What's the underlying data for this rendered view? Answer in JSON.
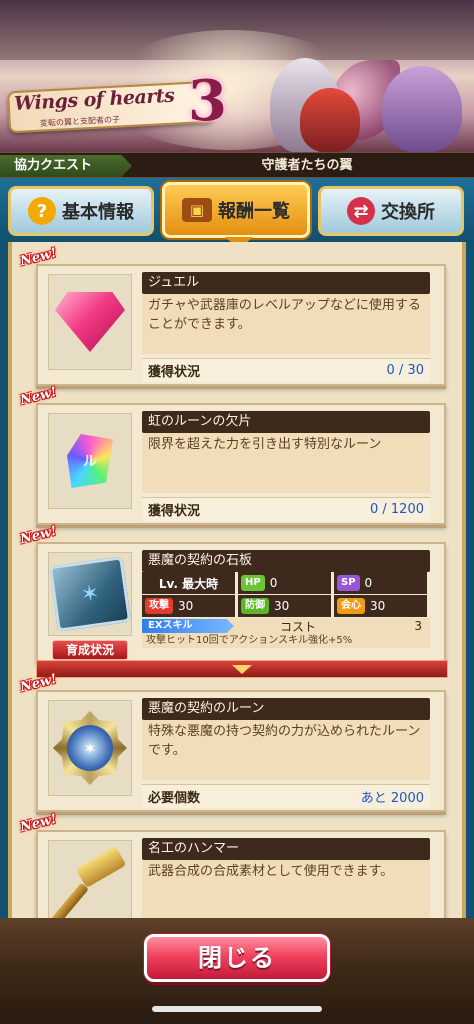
{
  "banner": {
    "logo_title": "Wings of hearts",
    "logo_number": "3",
    "logo_subtitle": "変転の翼と支配者の子"
  },
  "quest": {
    "label": "協力クエスト",
    "name": "守護者たちの翼"
  },
  "tabs": [
    {
      "label": "基本情報",
      "icon": "question-icon",
      "icon_glyph": "?"
    },
    {
      "label": "報酬一覧",
      "icon": "treasure-chest-icon",
      "icon_glyph": "▣"
    },
    {
      "label": "交換所",
      "icon": "exchange-bag-icon",
      "icon_glyph": "⇄"
    }
  ],
  "new_badge": "New!",
  "items": [
    {
      "title": "ジュエル",
      "description": "ガチャや武器庫のレベルアップなどに使用することができます。",
      "status_label": "獲得状況",
      "status_value": "0 / 30",
      "icon": "jewel-icon"
    },
    {
      "title": "虹のルーンの欠片",
      "description": "限界を超えた力を引き出す特別なルーン",
      "status_label": "獲得状況",
      "status_value": "0 / 1200",
      "icon": "rainbow-rune-icon"
    },
    {
      "title": "悪魔の契約の石板",
      "icon": "stone-tablet-icon",
      "level_label": "Lv. 最大時",
      "hp_label": "HP",
      "hp_value": "0",
      "sp_label": "SP",
      "sp_value": "0",
      "atk_label": "攻撃",
      "atk_value": "30",
      "def_label": "防御",
      "def_value": "30",
      "crit_label": "会心",
      "crit_value": "30",
      "ex_label": "EXスキル",
      "cost_label": "コスト",
      "cost_value": "3",
      "ex_description": "攻撃ヒット10回でアクションスキル強化+5%",
      "growth_button": "育成状況"
    },
    {
      "title": "悪魔の契約のルーン",
      "description": "特殊な悪魔の持つ契約の力が込められたルーンです。",
      "status_label": "必要個数",
      "status_value": "あと 2000",
      "icon": "demon-rune-medal-icon"
    },
    {
      "title": "名工のハンマー",
      "description": "武器合成の合成素材として使用できます。",
      "icon": "golden-hammer-icon"
    }
  ],
  "close_button": "閉じる",
  "colors": {
    "tab_bar": "#1f6f98",
    "active_tab": "#f0a020",
    "close_button": "#f0425e",
    "status_value": "#1d55c6"
  }
}
